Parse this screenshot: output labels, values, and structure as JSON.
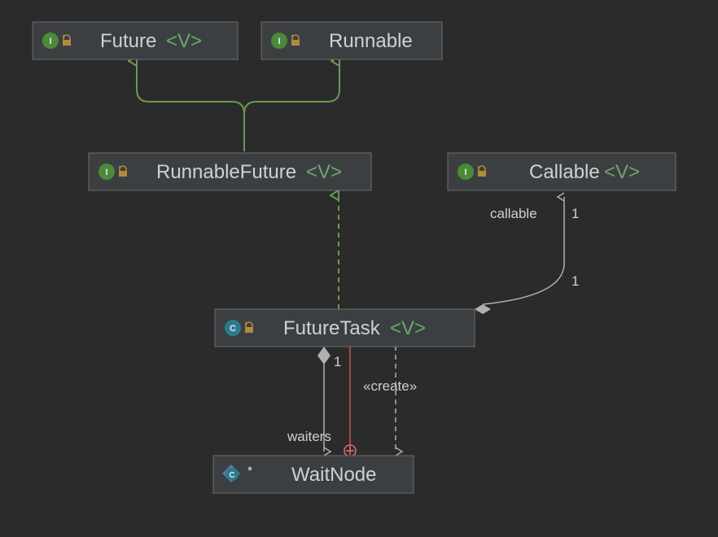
{
  "nodes": {
    "future": {
      "kind": "I",
      "name": "Future",
      "generic": "<V>"
    },
    "runnable": {
      "kind": "I",
      "name": "Runnable",
      "generic": ""
    },
    "runnableFuture": {
      "kind": "I",
      "name": "RunnableFuture",
      "generic": "<V>"
    },
    "callable": {
      "kind": "I",
      "name": "Callable",
      "generic": "<V>"
    },
    "futureTask": {
      "kind": "C",
      "name": "FutureTask",
      "generic": "<V>"
    },
    "waitNode": {
      "kind": "C",
      "name": "WaitNode",
      "generic": ""
    }
  },
  "edgeLabels": {
    "callable_role": "callable",
    "callable_mult_top": "1",
    "callable_mult_bot": "1",
    "create": "«create»",
    "waiters_role": "waiters",
    "waiters_mult": "1"
  },
  "colors": {
    "bg": "#2b2b2b",
    "box": "#3c3f41",
    "boxBorder": "#6b6e70",
    "text": "#d0d0d0",
    "generic": "#6ca86c",
    "inherit": "#6a9955",
    "assoc": "#b0b0b0",
    "errorRing": "#d96c6c"
  }
}
